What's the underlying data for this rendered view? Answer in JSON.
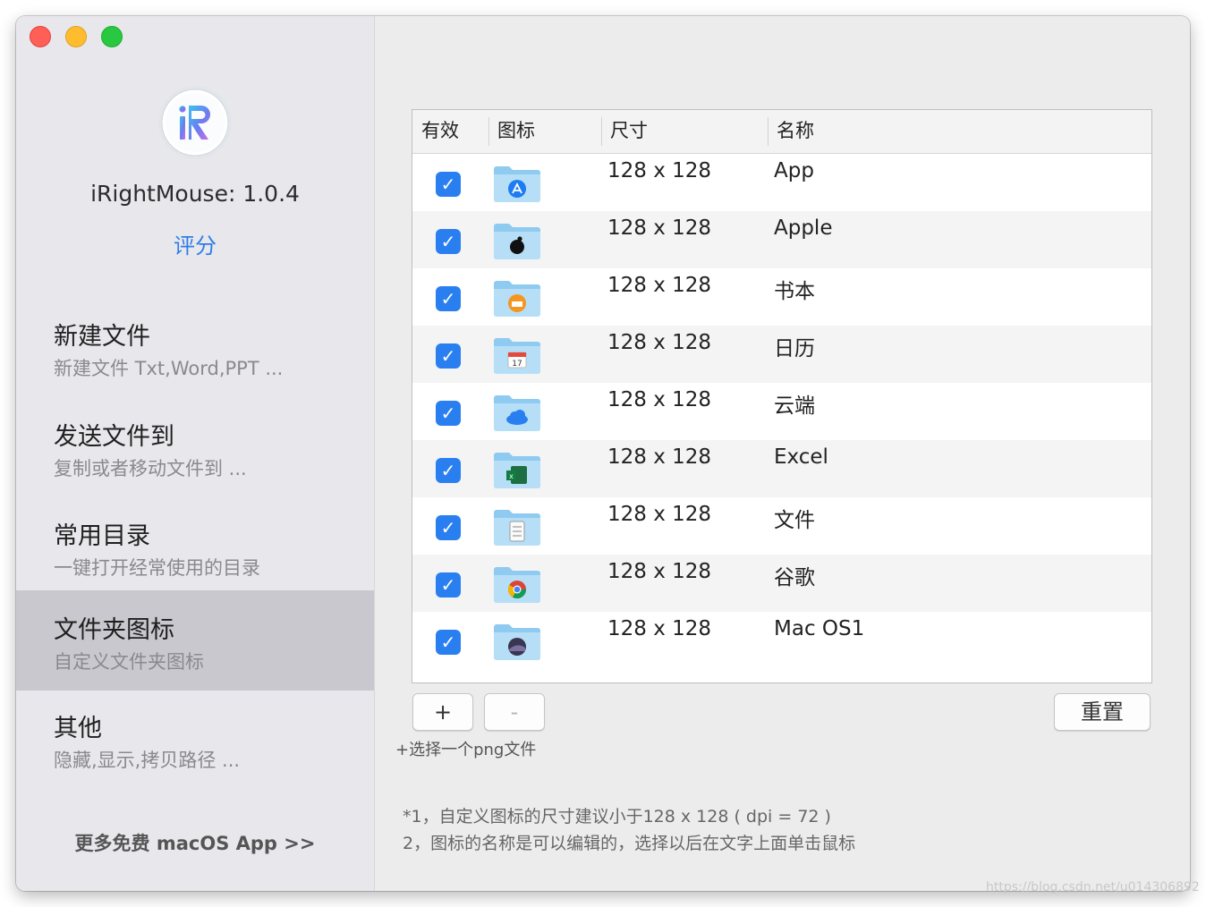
{
  "app": {
    "name_version": "iRightMouse: 1.0.4",
    "rate_label": "评分",
    "more_apps_label": "更多免费 macOS App >>"
  },
  "sidebar": {
    "items": [
      {
        "title": "新建文件",
        "subtitle": "新建文件 Txt,Word,PPT ...",
        "active": false
      },
      {
        "title": "发送文件到",
        "subtitle": "复制或者移动文件到 ...",
        "active": false
      },
      {
        "title": "常用目录",
        "subtitle": "一键打开经常使用的目录",
        "active": false
      },
      {
        "title": "文件夹图标",
        "subtitle": "自定义文件夹图标",
        "active": true
      },
      {
        "title": "其他",
        "subtitle": "隐藏,显示,拷贝路径 ...",
        "active": false
      }
    ]
  },
  "table": {
    "headers": {
      "enabled": "有效",
      "icon": "图标",
      "size": "尺寸",
      "name": "名称"
    },
    "rows": [
      {
        "enabled": true,
        "icon": "app-store-folder-icon",
        "size": "128 x 128",
        "name": "App"
      },
      {
        "enabled": true,
        "icon": "apple-folder-icon",
        "size": "128 x 128",
        "name": "Apple"
      },
      {
        "enabled": true,
        "icon": "books-folder-icon",
        "size": "128 x 128",
        "name": "书本"
      },
      {
        "enabled": true,
        "icon": "calendar-folder-icon",
        "size": "128 x 128",
        "name": "日历"
      },
      {
        "enabled": true,
        "icon": "cloud-folder-icon",
        "size": "128 x 128",
        "name": "云端"
      },
      {
        "enabled": true,
        "icon": "excel-folder-icon",
        "size": "128 x 128",
        "name": "Excel"
      },
      {
        "enabled": true,
        "icon": "document-folder-icon",
        "size": "128 x 128",
        "name": "文件"
      },
      {
        "enabled": true,
        "icon": "chrome-folder-icon",
        "size": "128 x 128",
        "name": "谷歌"
      },
      {
        "enabled": true,
        "icon": "macos-folder-icon",
        "size": "128 x 128",
        "name": "Mac OS1"
      }
    ]
  },
  "controls": {
    "add_label": "+",
    "remove_label": "-",
    "reset_label": "重置",
    "hint": "+选择一个png文件"
  },
  "notes": [
    "*1，自定义图标的尺寸建议小于128 x 128 ( dpi = 72 )",
    "  2，图标的名称是可以编辑的，选择以后在文字上面单击鼠标"
  ],
  "watermark": "https://blog.csdn.net/u014306892",
  "colors": {
    "accent": "#2a7ff0",
    "sidebar_active": "#c9c8ce",
    "link": "#2f7ee8"
  }
}
